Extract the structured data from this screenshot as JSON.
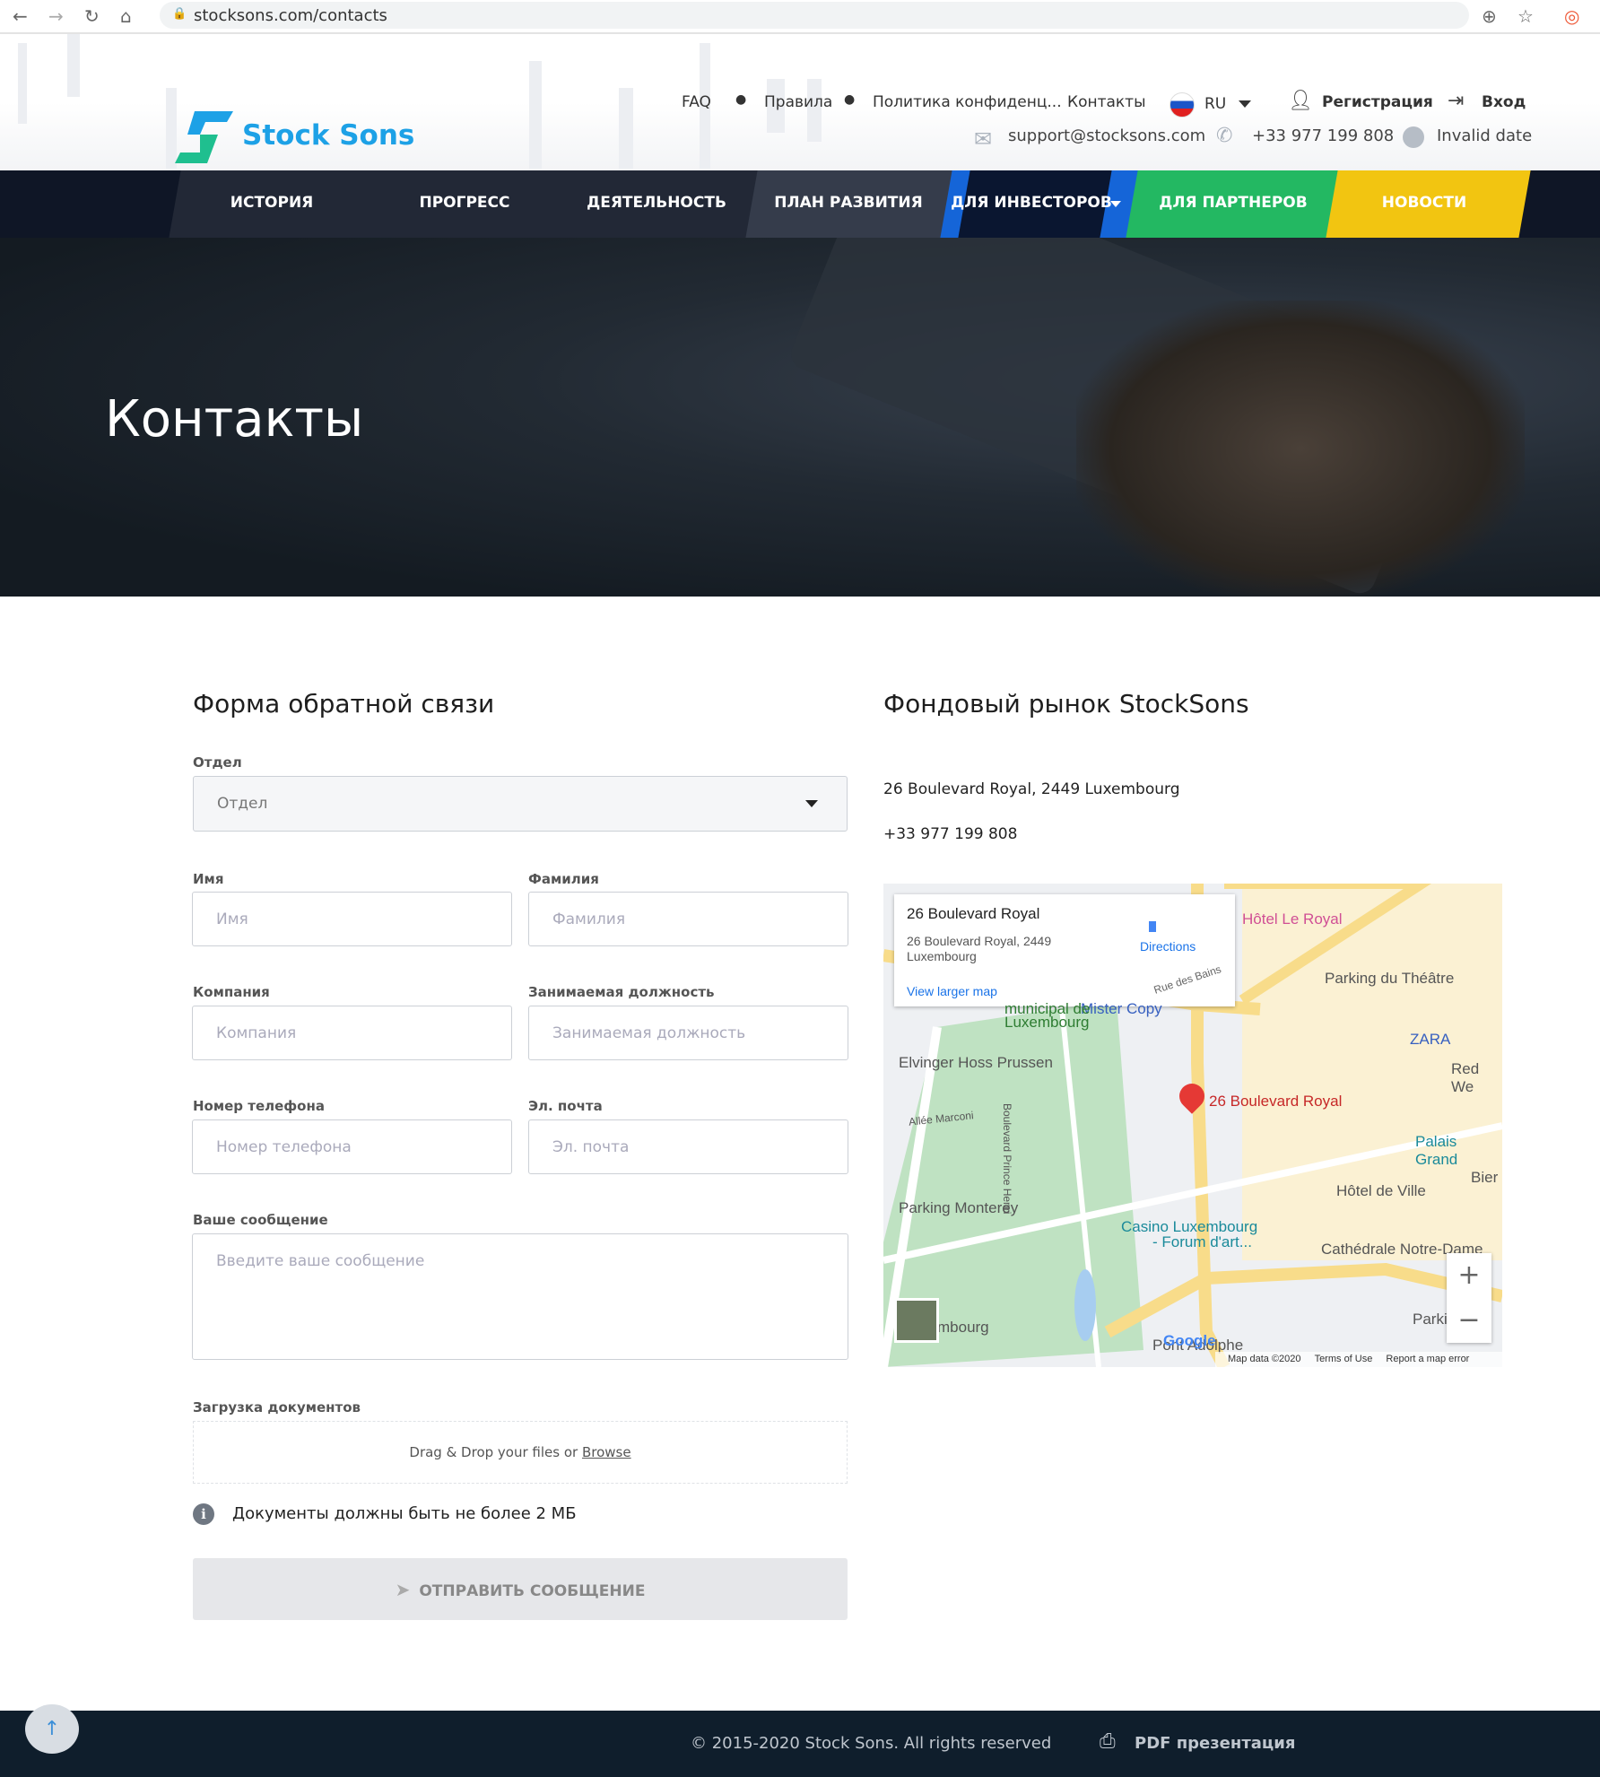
{
  "browser": {
    "url": "stocksons.com/contacts"
  },
  "brand": {
    "name": "Stock Sons",
    "accent": "#1da1e6"
  },
  "topnav": {
    "faq": "FAQ",
    "rules": "Правила",
    "privacy": "Политика конфиденц...",
    "contacts": "Контакты",
    "lang": "RU",
    "register": "Регистрация",
    "login": "Вход"
  },
  "contact": {
    "email": "support@stocksons.com",
    "phone": "+33 977 199 808",
    "date": "Invalid date"
  },
  "nav": [
    "ИСТОРИЯ",
    "ПРОГРЕСС",
    "ДЕЯТЕЛЬНОСТЬ",
    "ПЛАН РАЗВИТИЯ",
    "ДЛЯ ИНВЕСТОРОВ",
    "ДЛЯ ПАРТНЕРОВ",
    "НОВОСТИ"
  ],
  "hero": {
    "title": "Контакты"
  },
  "form": {
    "title": "Форма обратной связи",
    "department": {
      "label": "Отдел",
      "value": "Отдел"
    },
    "first_name": {
      "label": "Имя",
      "placeholder": "Имя"
    },
    "last_name": {
      "label": "Фамилия",
      "placeholder": "Фамилия"
    },
    "company": {
      "label": "Компания",
      "placeholder": "Компания"
    },
    "position": {
      "label": "Занимаемая должность",
      "placeholder": "Занимаемая должность"
    },
    "phone": {
      "label": "Номер телефона",
      "placeholder": "Номер телефона"
    },
    "email": {
      "label": "Эл. почта",
      "placeholder": "Эл. почта"
    },
    "message": {
      "label": "Ваше сообщение",
      "placeholder": "Введите ваше сообщение"
    },
    "upload": {
      "label": "Загрузка документов",
      "text": "Drag & Drop your files or",
      "browse": "Browse"
    },
    "note": "Документы должны быть не более 2 МБ",
    "submit": "ОТПРАВИТЬ СООБЩЕНИЕ"
  },
  "info": {
    "title": "Фондовый рынок StockSons",
    "address": "26 Boulevard Royal, 2449 Luxembourg",
    "phone": "+33 977 199 808"
  },
  "map": {
    "card_title": "26 Boulevard Royal",
    "card_address1": "26 Boulevard Royal, 2449",
    "card_address2": "Luxembourg",
    "directions": "Directions",
    "larger": "View larger map",
    "pin": "26 Boulevard Royal",
    "labels": [
      "Hôtel Le Royal",
      "Parking du Théâtre",
      "Rue des Bains",
      "ZARA",
      "Red We",
      "Palais Grand",
      "Bier",
      "Hôtel de Ville",
      "Mister Copy",
      "municipal de",
      "Luxembourg",
      "Elvinger Hoss Prussen",
      "Allée Marconi",
      "Boulevard Prince Henri",
      "Parking Monterey",
      "Casino Luxembourg",
      "- Forum d'art...",
      "Cathédrale Notre-Dame",
      "Parki",
      "Pont Adolphe",
      "mbourg"
    ],
    "attribution": "Map data ©2020",
    "terms": "Terms of Use",
    "report": "Report a map error",
    "google": "Google"
  },
  "footer": {
    "copyright": "© 2015-2020 Stock Sons. All rights reserved",
    "pdf": "PDF презентация"
  }
}
